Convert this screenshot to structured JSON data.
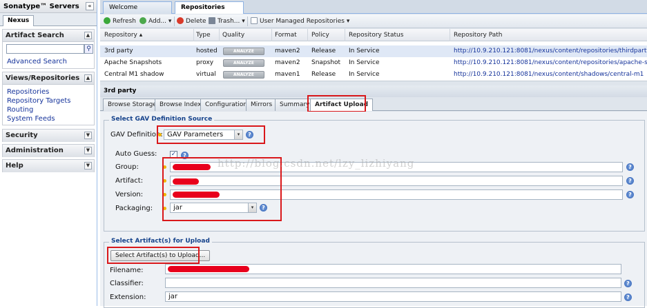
{
  "left": {
    "title": "Sonatype™ Servers",
    "collapse_glyph": "«",
    "tab": "Nexus",
    "artifact_search": {
      "title": "Artifact Search",
      "search_glyph": "⚲",
      "advanced": "Advanced Search",
      "toggle": "▲"
    },
    "views": {
      "title": "Views/Repositories",
      "toggle": "▲",
      "links": [
        "Repositories",
        "Repository Targets",
        "Routing",
        "System Feeds"
      ]
    },
    "security": {
      "title": "Security",
      "toggle": "▼"
    },
    "administration": {
      "title": "Administration",
      "toggle": "▼"
    },
    "help": {
      "title": "Help",
      "toggle": "▼"
    }
  },
  "tabs": [
    "Welcome",
    "Repositories"
  ],
  "toolbar": {
    "refresh": "Refresh",
    "add": "Add... ▾",
    "delete": "Delete",
    "trash": "Trash... ▾",
    "user_managed": "User Managed Repositories ▾"
  },
  "grid": {
    "headers": [
      "Repository ▴",
      "Type",
      "Quality",
      "Format",
      "Policy",
      "Repository Status",
      "Repository Path"
    ],
    "analyze_label": "ANALYZE",
    "rows": [
      {
        "name": "3rd party",
        "type": "hosted",
        "format": "maven2",
        "policy": "Release",
        "status": "In Service",
        "path": "http://10.9.210.121:8081/nexus/content/repositories/thirdparty"
      },
      {
        "name": "Apache Snapshots",
        "type": "proxy",
        "format": "maven2",
        "policy": "Snapshot",
        "status": "In Service",
        "path": "http://10.9.210.121:8081/nexus/content/repositories/apache-snapshots"
      },
      {
        "name": "Central M1 shadow",
        "type": "virtual",
        "format": "maven1",
        "policy": "Release",
        "status": "In Service",
        "path": "http://10.9.210.121:8081/nexus/content/shadows/central-m1"
      }
    ]
  },
  "detail": {
    "title": "3rd party",
    "tabs": [
      "Browse Storage",
      "Browse Index",
      "Configuration",
      "Mirrors",
      "Summary",
      "Artifact Upload"
    ]
  },
  "gav": {
    "legend": "Select GAV Definition Source",
    "definition_label": "GAV Definition:",
    "definition_value": "GAV Parameters",
    "combo_glyph": "▾",
    "help_glyph": "?",
    "check_glyph": "✓",
    "auto_guess_label": "Auto Guess:",
    "group_label": "Group:",
    "artifact_label": "Artifact:",
    "version_label": "Version:",
    "packaging_label": "Packaging:",
    "packaging_value": "jar"
  },
  "upload": {
    "legend": "Select Artifact(s) for Upload",
    "button": "Select Artifact(s) to Upload...",
    "filename_label": "Filename:",
    "classifier_label": "Classifier:",
    "extension_label": "Extension:",
    "extension_value": "jar"
  },
  "watermark": "http://blog.csdn.net/lzy_lizhiyang",
  "colors": {
    "highlight": "#d9171a",
    "redaction": "#e8001c",
    "link": "#14329a",
    "selected_row": "#dfe8f6"
  }
}
